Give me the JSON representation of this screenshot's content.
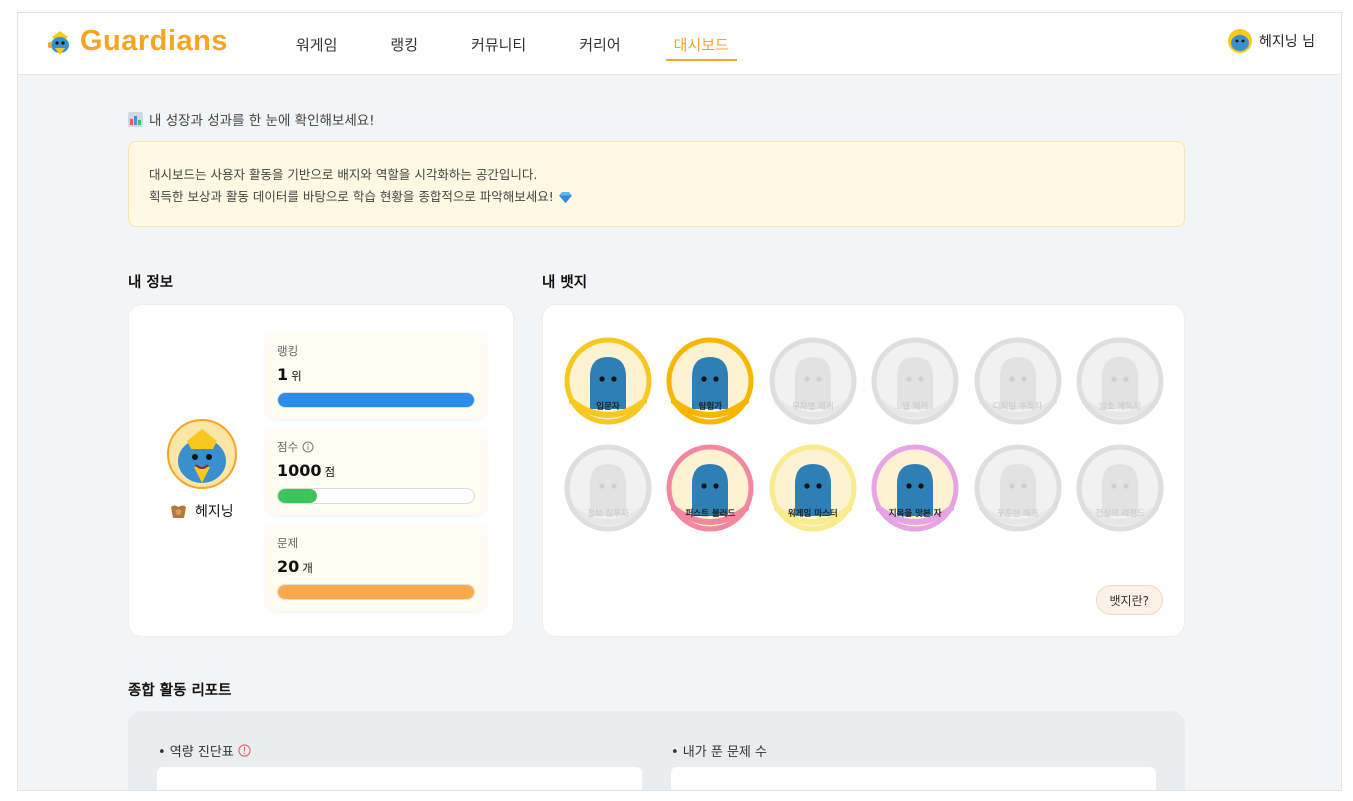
{
  "header": {
    "logo_text": "Guardians",
    "nav": [
      "워게임",
      "랭킹",
      "커뮤니티",
      "커리어",
      "대시보드"
    ],
    "active_nav": "대시보드",
    "user_label": "헤지닝 님"
  },
  "intro": {
    "title": "내 성장과 성과를 한 눈에 확인해보세요!",
    "notice_line1": "대시보드는 사용자 활동을 기반으로 배지와 역할을 시각화하는 공간입니다.",
    "notice_line2": "획득한 보상과 활동 데이터를 바탕으로 학습 현황을 종합적으로 파악해보세요!"
  },
  "my_info": {
    "section_title": "내 정보",
    "nickname": "헤지닝",
    "stats": [
      {
        "label": "랭킹",
        "value": "1",
        "unit": "위",
        "fill": 1.0,
        "color": "#2b8ce6"
      },
      {
        "label": "점수",
        "value": "1000",
        "unit": "점",
        "fill": 0.2,
        "color": "#3cc45c"
      },
      {
        "label": "문제",
        "value": "20",
        "unit": "개",
        "fill": 1.0,
        "color": "#ffa94d"
      }
    ]
  },
  "badges": {
    "section_title": "내 뱃지",
    "help_label": "뱃지란?",
    "items": [
      {
        "label": "입문자",
        "earned": true,
        "ring": "#f8c81f"
      },
      {
        "label": "탐험가",
        "earned": true,
        "ring": "#f8b600"
      },
      {
        "label": "무차별 해커",
        "earned": false,
        "ring": "#dedede"
      },
      {
        "label": "웹 해커",
        "earned": false,
        "ring": "#dedede"
      },
      {
        "label": "디지털 추적자",
        "earned": false,
        "ring": "#dedede"
      },
      {
        "label": "암호 해독자",
        "earned": false,
        "ring": "#dedede"
      },
      {
        "label": "정보 침투자",
        "earned": false,
        "ring": "#dedede"
      },
      {
        "label": "퍼스트 블러드",
        "earned": true,
        "ring": "#f3879f"
      },
      {
        "label": "워게임 마스터",
        "earned": true,
        "ring": "#f9eb8e"
      },
      {
        "label": "지옥을 맛본 자",
        "earned": true,
        "ring": "#e7a3e3"
      },
      {
        "label": "꾸준한 해커",
        "earned": false,
        "ring": "#dedede"
      },
      {
        "label": "전설의 레전드",
        "earned": false,
        "ring": "#dedede"
      }
    ]
  },
  "report": {
    "section_title": "종합 활동 리포트",
    "left_title": "• 역량 진단표",
    "right_title": "• 내가 푼 문제 수"
  }
}
